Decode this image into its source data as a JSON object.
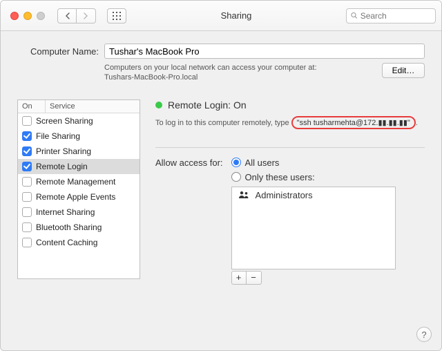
{
  "titlebar": {
    "title": "Sharing",
    "search_placeholder": "Search"
  },
  "computer_name": {
    "label": "Computer Name:",
    "value": "Tushar's MacBook Pro",
    "sub_line1": "Computers on your local network can access your computer at:",
    "sub_line2": "Tushars-MacBook-Pro.local",
    "edit_label": "Edit…"
  },
  "services": {
    "col_on": "On",
    "col_service": "Service",
    "items": [
      {
        "name": "Screen Sharing",
        "on": false
      },
      {
        "name": "File Sharing",
        "on": true
      },
      {
        "name": "Printer Sharing",
        "on": true
      },
      {
        "name": "Remote Login",
        "on": true,
        "selected": true
      },
      {
        "name": "Remote Management",
        "on": false
      },
      {
        "name": "Remote Apple Events",
        "on": false
      },
      {
        "name": "Internet Sharing",
        "on": false
      },
      {
        "name": "Bluetooth Sharing",
        "on": false
      },
      {
        "name": "Content Caching",
        "on": false
      }
    ]
  },
  "status": {
    "title": "Remote Login: On",
    "login_prefix": "To log in to this computer remotely, type ",
    "login_cmd": "\"ssh tusharmehta@172.▮▮.▮▮.▮▮\"",
    "login_suffix": "."
  },
  "access": {
    "label": "Allow access for:",
    "all_users": "All users",
    "only_these": "Only these users:",
    "selected": "all",
    "users": [
      "Administrators"
    ],
    "plus": "+",
    "minus": "−"
  },
  "help": "?"
}
